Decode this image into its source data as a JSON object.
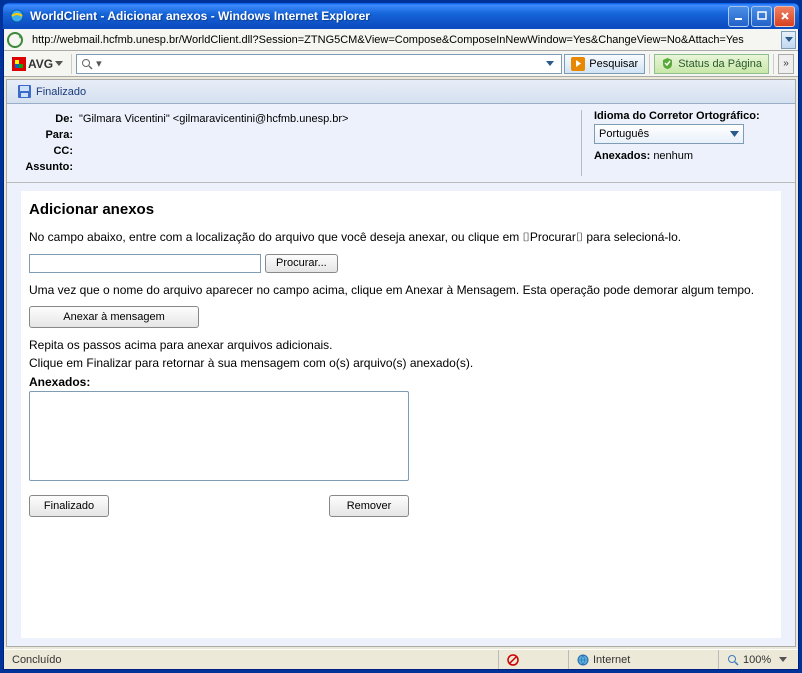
{
  "window": {
    "title": "WorldClient - Adicionar anexos - Windows Internet Explorer",
    "url": "http://webmail.hcfmb.unesp.br/WorldClient.dll?Session=ZTNG5CM&View=Compose&ComposeInNewWindow=Yes&ChangeView=No&Attach=Yes"
  },
  "avg": {
    "label": "AVG",
    "search_placeholder": "",
    "pesquisar": "Pesquisar",
    "status": "Status da Página"
  },
  "topbar": {
    "finalizado": "Finalizado"
  },
  "header": {
    "de_label": "De:",
    "de_value": "\"Gilmara Vicentini\" <gilmaravicentini@hcfmb.unesp.br>",
    "para_label": "Para:",
    "para_value": "",
    "cc_label": "CC:",
    "cc_value": "",
    "assunto_label": "Assunto:",
    "assunto_value": "",
    "idioma_label": "Idioma do Corretor Ortográfico:",
    "idioma_value": "Português",
    "anexados_label": "Anexados:",
    "anexados_value": "nenhum"
  },
  "body": {
    "h2": "Adicionar anexos",
    "intro": "No campo abaixo, entre com a localização do arquivo que você deseja anexar, ou clique em ⌷Procurar⌷ para selecioná-lo.",
    "procurar": "Procurar...",
    "after_browse": "Uma vez que o nome do arquivo aparecer no campo acima, clique em Anexar à Mensagem. Esta operação pode demorar algum tempo.",
    "anexar_btn": "Anexar à mensagem",
    "repeat1": "Repita os passos acima para anexar arquivos adicionais.",
    "repeat2": "Clique em Finalizar para retornar à sua mensagem com o(s) arquivo(s) anexado(s).",
    "anexados_label": "Anexados:",
    "finalizado_btn": "Finalizado",
    "remover_btn": "Remover"
  },
  "statusbar": {
    "concluido": "Concluído",
    "zone": "Internet",
    "zoom": "100%"
  }
}
